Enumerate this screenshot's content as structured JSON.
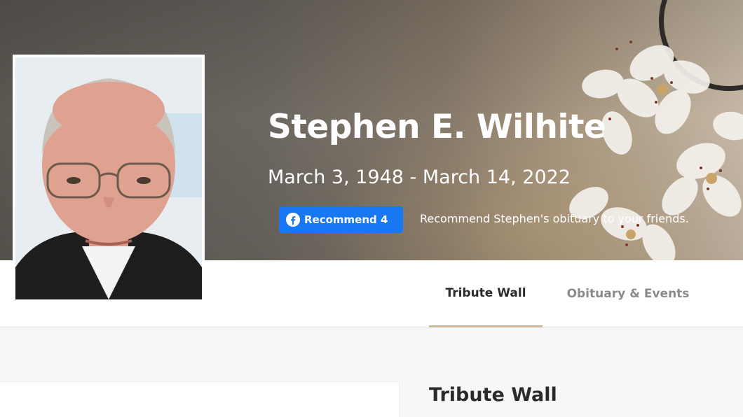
{
  "header": {
    "name": "Stephen E. Wilhite",
    "dates": "March 3, 1948 - March 14, 2022"
  },
  "facebook": {
    "button_label": "Recommend 4",
    "note": "Recommend Stephen's obituary to your friends."
  },
  "tabs": [
    {
      "label": "Tribute Wall",
      "active": true
    },
    {
      "label": "Obituary & Events",
      "active": false
    }
  ],
  "main": {
    "section_title": "Tribute Wall"
  },
  "colors": {
    "facebook_blue": "#1877f2",
    "tab_underline": "#c9b89a"
  },
  "icons": [
    "facebook-icon",
    "blossom-decoration"
  ]
}
